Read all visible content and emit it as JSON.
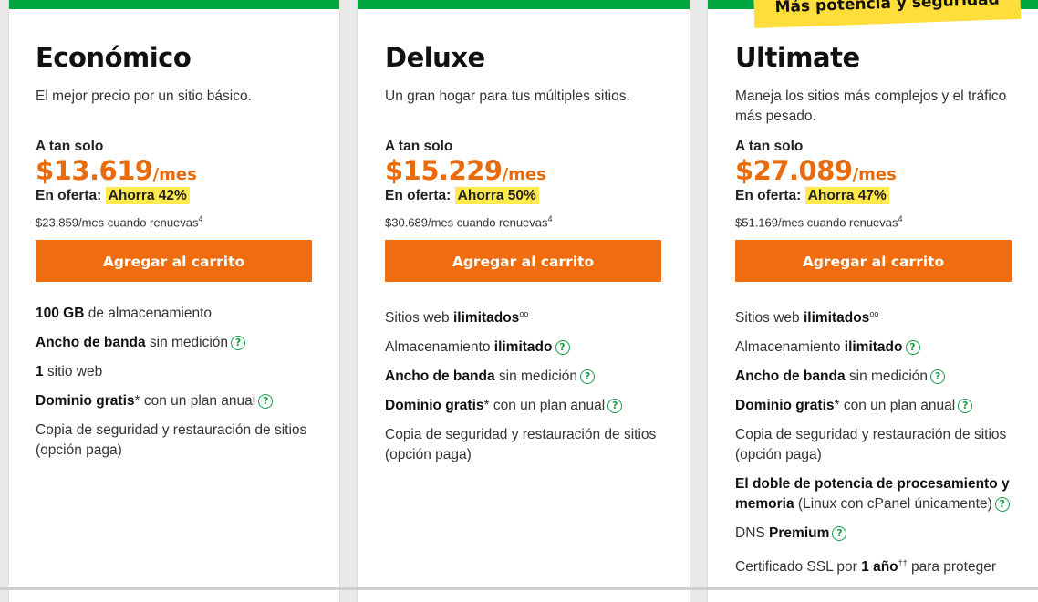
{
  "banner": "Más potencia y seguridad",
  "colors": {
    "accent": "#e96b0c",
    "top_bar": "#00a63f",
    "highlight": "#ffe94b",
    "help_icon": "#1a9b48"
  },
  "plans": [
    {
      "title": "Económico",
      "tagline": "El mejor precio por un sitio básico.",
      "price_intro": "A tan solo",
      "price": "$13.619",
      "per": "/mes",
      "offer_label": "En oferta:",
      "savings": "Ahorra 42%",
      "renew": "$23.859/mes cuando renuevas",
      "renew_sup": "4",
      "cart": "Agregar al carrito",
      "features": {
        "f1": {
          "bold": "100 GB",
          "text": " de almacenamiento"
        },
        "f2": {
          "bold": "Ancho de banda",
          "text": " sin medición"
        },
        "f3": {
          "bold": "1",
          "text": " sitio web"
        },
        "f4": {
          "bold": "Dominio gratis",
          "text": "* con un plan anual"
        },
        "f5": {
          "text": "Copia de seguridad y restauración de sitios (opción paga)"
        }
      }
    },
    {
      "title": "Deluxe",
      "tagline": "Un gran hogar para tus múltiples sitios.",
      "price_intro": "A tan solo",
      "price": "$15.229",
      "per": "/mes",
      "offer_label": "En oferta:",
      "savings": "Ahorra 50%",
      "renew": "$30.689/mes cuando renuevas",
      "renew_sup": "4",
      "cart": "Agregar al carrito",
      "features": {
        "f1": {
          "text": "Sitios web ",
          "bold": "ilimitados",
          "sup": "oo"
        },
        "f2": {
          "text": "Almacenamiento ",
          "bold": "ilimitado"
        },
        "f3": {
          "bold": "Ancho de banda",
          "text": " sin medición"
        },
        "f4": {
          "bold": "Dominio gratis",
          "text": "* con un plan anual"
        },
        "f5": {
          "text": "Copia de seguridad y restauración de sitios (opción paga)"
        }
      }
    },
    {
      "title": "Ultimate",
      "tagline": "Maneja los sitios más complejos y el tráfico más pesado.",
      "price_intro": "A tan solo",
      "price": "$27.089",
      "per": "/mes",
      "offer_label": "En oferta:",
      "savings": "Ahorra 47%",
      "renew": "$51.169/mes cuando renuevas",
      "renew_sup": "4",
      "cart": "Agregar al carrito",
      "features": {
        "f1": {
          "text": "Sitios web ",
          "bold": "ilimitados",
          "sup": "oo"
        },
        "f2": {
          "text": "Almacenamiento ",
          "bold": "ilimitado"
        },
        "f3": {
          "bold": "Ancho de banda",
          "text": " sin medición"
        },
        "f4": {
          "bold": "Dominio gratis",
          "text": "* con un plan anual"
        },
        "f5": {
          "text": "Copia de seguridad y restauración de sitios (opción paga)"
        },
        "f6": {
          "bold": "El doble de potencia de procesamiento y memoria",
          "text": " (Linux con cPanel únicamente)"
        },
        "f7": {
          "text": "DNS ",
          "bold": "Premium"
        },
        "f8": {
          "text_before": "Certificado SSL por ",
          "bold": "1 año",
          "sup": "††",
          "text_after": " para proteger"
        }
      }
    }
  ]
}
